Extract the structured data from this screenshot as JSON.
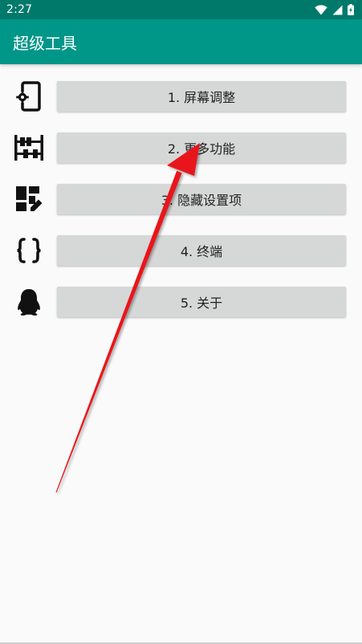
{
  "status_bar": {
    "time": "2:27",
    "icons": [
      "wifi-icon",
      "signal-icon",
      "battery-icon"
    ]
  },
  "app_bar": {
    "title": "超级工具"
  },
  "menu": {
    "items": [
      {
        "label": "1. 屏幕调整",
        "icon": "phone-settings-icon"
      },
      {
        "label": "2. 更多功能",
        "icon": "abacus-icon"
      },
      {
        "label": "3. 隐藏设置项",
        "icon": "dashboard-edit-icon"
      },
      {
        "label": "4. 终端",
        "icon": "code-braces-icon"
      },
      {
        "label": "5. 关于",
        "icon": "qq-penguin-icon"
      }
    ]
  },
  "colors": {
    "status_bar": "#00796b",
    "app_bar": "#009688",
    "background": "#fafafa",
    "button": "#d6d7d7",
    "annotation_arrow": "#e8141a"
  }
}
